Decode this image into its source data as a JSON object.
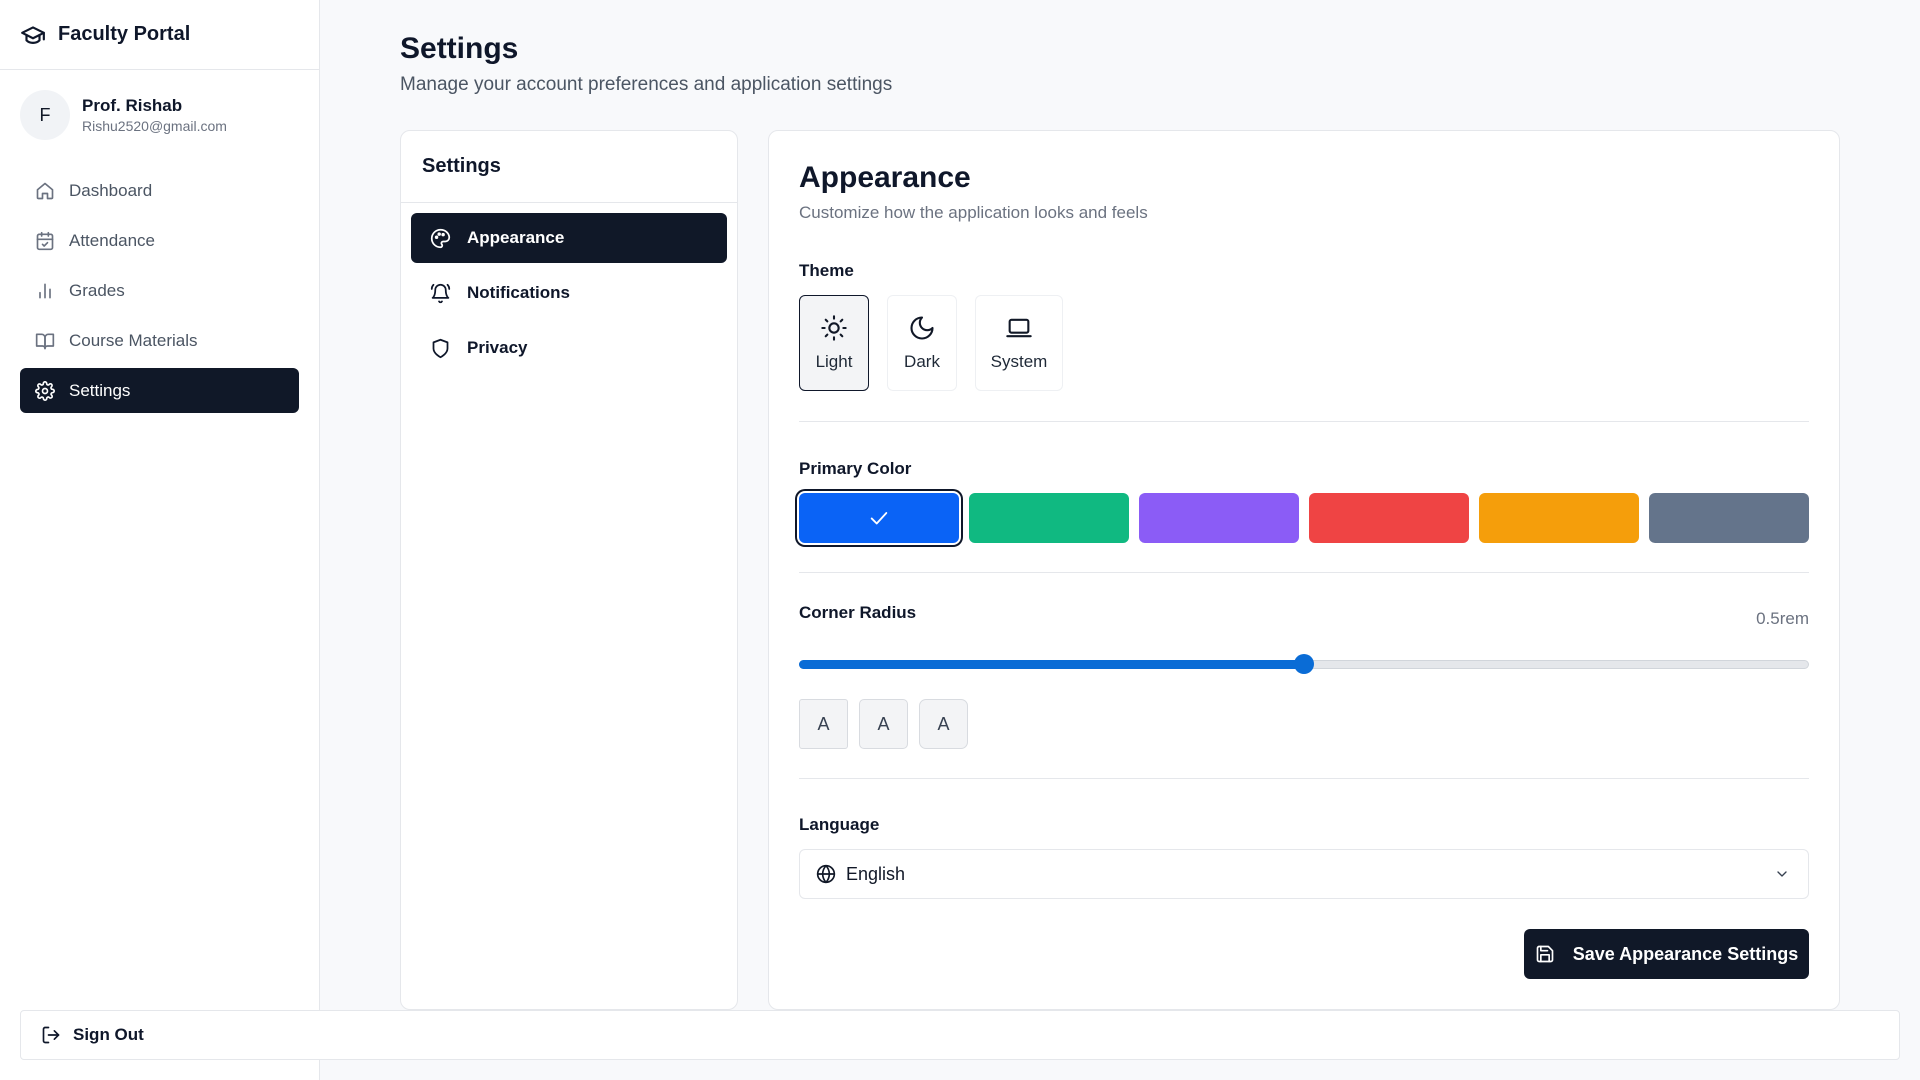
{
  "app": {
    "title": "Faculty Portal",
    "icon": "graduation-cap-icon"
  },
  "user": {
    "initial": "F",
    "name": "Prof. Rishab",
    "email": "Rishu2520@gmail.com"
  },
  "nav": {
    "items": [
      {
        "label": "Dashboard",
        "icon": "home-icon",
        "active": false
      },
      {
        "label": "Attendance",
        "icon": "calendar-check-icon",
        "active": false
      },
      {
        "label": "Grades",
        "icon": "bar-chart-icon",
        "active": false
      },
      {
        "label": "Course Materials",
        "icon": "book-open-icon",
        "active": false
      },
      {
        "label": "Settings",
        "icon": "gear-icon",
        "active": true
      }
    ],
    "sign_out_label": "Sign Out"
  },
  "page": {
    "title": "Settings",
    "subtitle": "Manage your account preferences and application settings"
  },
  "settings_menu": {
    "title": "Settings",
    "items": [
      {
        "label": "Appearance",
        "icon": "palette-icon",
        "active": true
      },
      {
        "label": "Notifications",
        "icon": "bell-ring-icon",
        "active": false
      },
      {
        "label": "Privacy",
        "icon": "shield-icon",
        "active": false
      }
    ]
  },
  "appearance": {
    "title": "Appearance",
    "description": "Customize how the application looks and feels",
    "theme": {
      "label": "Theme",
      "selected": "Light",
      "options": [
        {
          "label": "Light",
          "icon": "sun-icon"
        },
        {
          "label": "Dark",
          "icon": "moon-icon"
        },
        {
          "label": "System",
          "icon": "laptop-icon"
        }
      ]
    },
    "primary_color": {
      "label": "Primary Color",
      "selected_index": 0,
      "options": [
        "#0a63f6",
        "#10b981",
        "#8b5cf6",
        "#ef4444",
        "#f59e0b",
        "#64748b"
      ]
    },
    "corner_radius": {
      "label": "Corner Radius",
      "value_text": "0.5rem",
      "slider_fraction": 0.5,
      "size_previews": [
        "A",
        "A",
        "A"
      ]
    },
    "language": {
      "label": "Language",
      "selected": "English",
      "icon": "globe-icon"
    },
    "save_label": "Save Appearance Settings"
  }
}
